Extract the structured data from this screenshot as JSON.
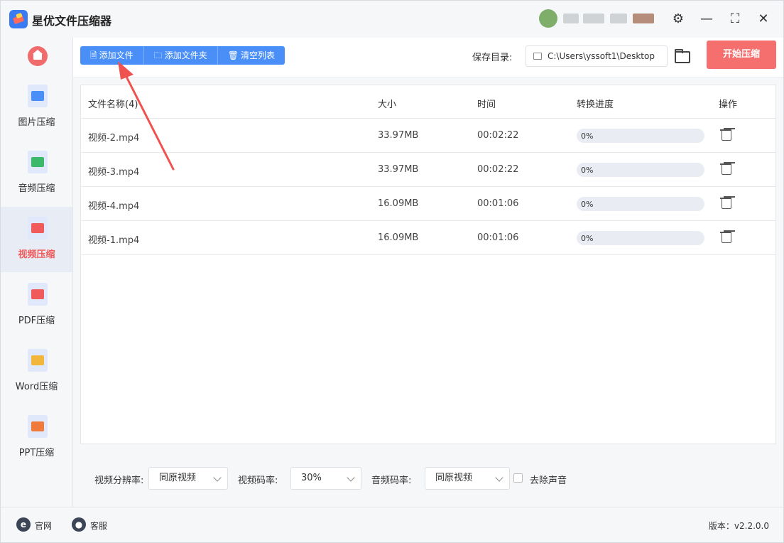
{
  "app": {
    "title": "星优文件压缩器"
  },
  "window_controls": {
    "settings": "⚙",
    "minimize": "—",
    "maximize": "⛶",
    "close": "✕"
  },
  "sidebar": {
    "items": [
      {
        "label": "图片压缩",
        "icon": "image-icon",
        "color": "#4a8ff7",
        "active": false
      },
      {
        "label": "音频压缩",
        "icon": "music-icon",
        "color": "#3bb86a",
        "active": false
      },
      {
        "label": "视频压缩",
        "icon": "video-icon",
        "color": "#f05a5a",
        "active": true
      },
      {
        "label": "PDF压缩",
        "icon": "pdf-icon",
        "color": "#f05a5a",
        "active": false
      },
      {
        "label": "Word压缩",
        "icon": "word-icon",
        "color": "#f2b63a",
        "active": false
      },
      {
        "label": "PPT压缩",
        "icon": "ppt-icon",
        "color": "#f07a3a",
        "active": false
      }
    ]
  },
  "toolbar": {
    "add_file": "添加文件",
    "add_folder": "添加文件夹",
    "clear_list": "清空列表",
    "save_dir_label": "保存目录:",
    "save_dir_value": "C:\\Users\\yssoft1\\Desktop",
    "start_label": "开始压缩"
  },
  "table": {
    "headers": {
      "name": "文件名称(4)",
      "size": "大小",
      "time": "时间",
      "progress": "转换进度",
      "action": "操作"
    },
    "rows": [
      {
        "name": "视频-2.mp4",
        "size": "33.97MB",
        "time": "00:02:22",
        "progress_text": "0%",
        "progress": 0
      },
      {
        "name": "视频-3.mp4",
        "size": "33.97MB",
        "time": "00:02:22",
        "progress_text": "0%",
        "progress": 0
      },
      {
        "name": "视频-4.mp4",
        "size": "16.09MB",
        "time": "00:01:06",
        "progress_text": "0%",
        "progress": 0
      },
      {
        "name": "视频-1.mp4",
        "size": "16.09MB",
        "time": "00:01:06",
        "progress_text": "0%",
        "progress": 0
      }
    ]
  },
  "settings": {
    "resolution_label": "视频分辨率:",
    "resolution_value": "同原视频",
    "bitrate_label": "视频码率:",
    "bitrate_value": "30%",
    "audio_label": "音频码率:",
    "audio_value": "同原视频",
    "mute_label": "去除声音"
  },
  "footer": {
    "website": "官网",
    "support": "客服",
    "version": "版本：v2.2.0.0"
  },
  "colors": {
    "primary_blue": "#4a8ff7",
    "accent_red": "#f56f6f",
    "arrow_red": "#f0524f"
  }
}
